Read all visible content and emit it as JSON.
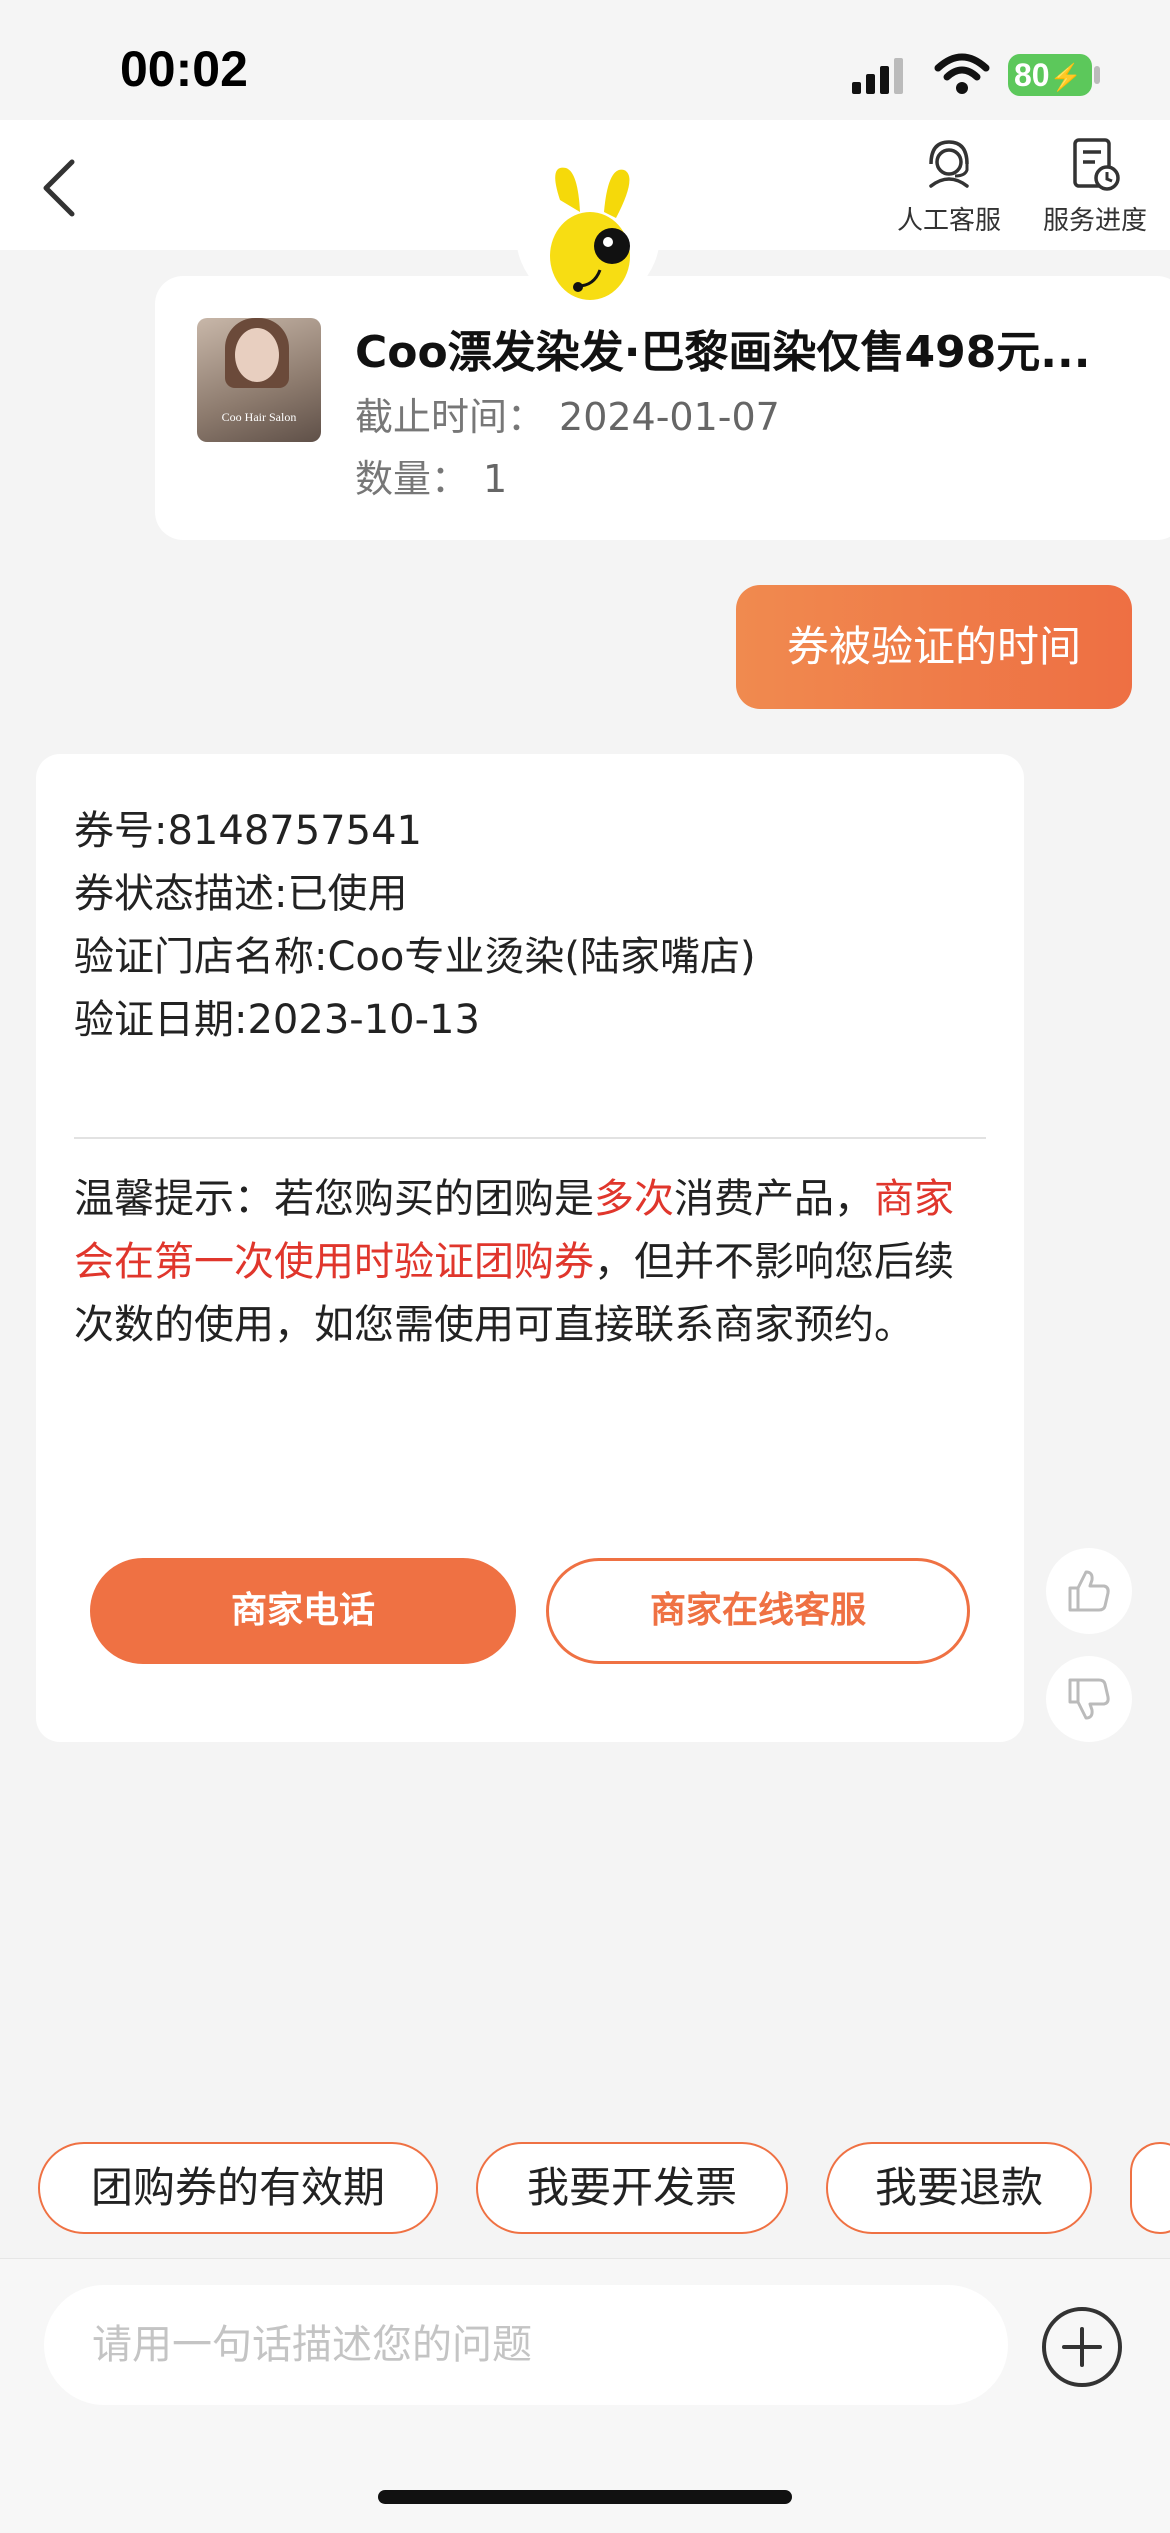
{
  "status_bar": {
    "time": "00:02",
    "battery": "80"
  },
  "header": {
    "human_service_label": "人工客服",
    "service_progress_label": "服务进度"
  },
  "product": {
    "thumb_text": "Coo Hair Salon",
    "title": "Coo漂发染发·巴黎画染仅售498元...",
    "deadline_label": "截止时间：",
    "deadline_value": "2024-01-07",
    "quantity_label": "数量：",
    "quantity_value": "1"
  },
  "user_message": "券被验证的时间",
  "answer": {
    "lines": [
      "券号:8148757541",
      "券状态描述:已使用",
      "验证门店名称:Coo专业烫染(陆家嘴店)",
      "验证日期:2023-10-13"
    ],
    "tip_part1": "温馨提示：若您购买的团购是",
    "tip_hl1": "多次",
    "tip_part2": "消费产品，",
    "tip_hl2": "商家会在第一次使用时验证团购券",
    "tip_part3": "，但并不影响您后续次数的使用，如您需使用可直接联系商家预约。",
    "call_button": "商家电话",
    "online_button": "商家在线客服"
  },
  "suggestions": [
    "团购券的有效期",
    "我要开发票",
    "我要退款"
  ],
  "input": {
    "placeholder": "请用一句话描述您的问题"
  },
  "colors": {
    "accent": "#ef7143",
    "highlight": "#e0362c",
    "battery": "#5cc85b"
  }
}
